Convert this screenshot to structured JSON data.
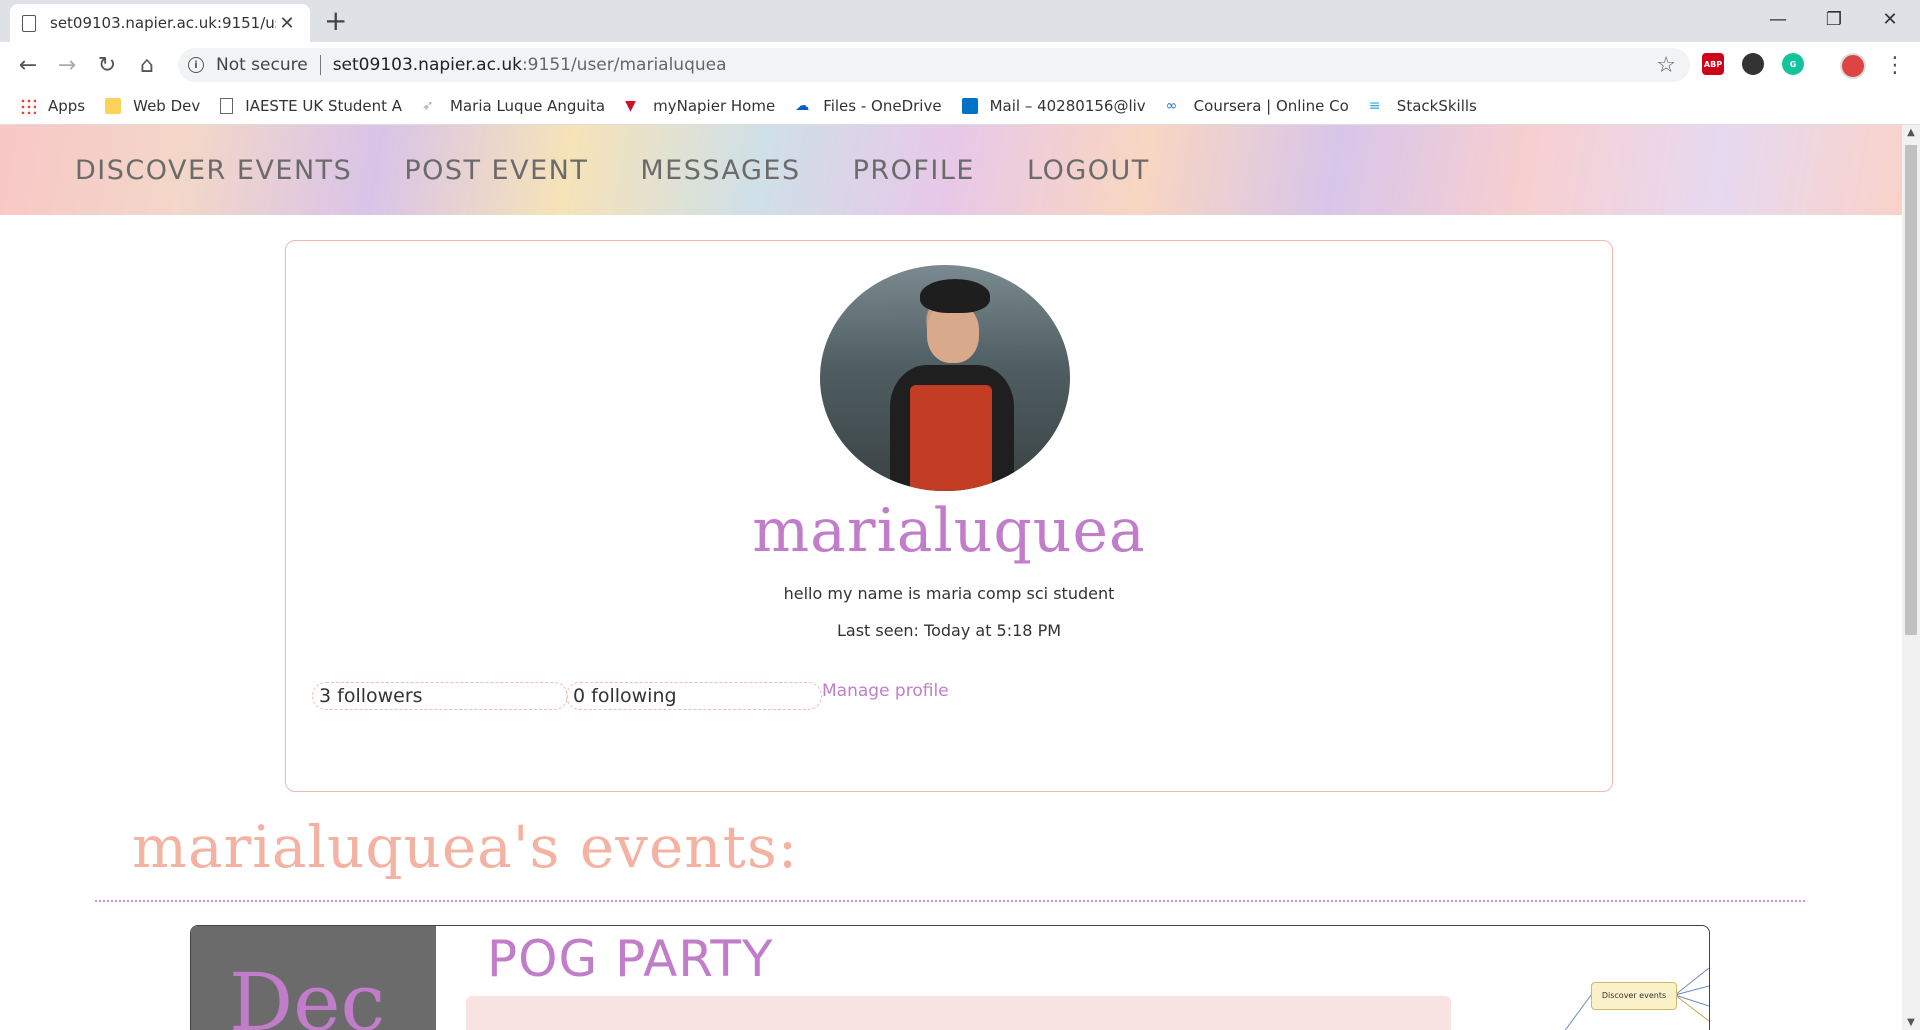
{
  "browser": {
    "tab_title": "set09103.napier.ac.uk:9151/user/",
    "address_security": "Not secure",
    "url_host": "set09103.napier.ac.uk",
    "url_path": ":9151/user/marialuquea",
    "bookmarks": [
      {
        "label": "Apps",
        "icon": "apps-grid-icon",
        "color": "#ea4335"
      },
      {
        "label": "Web Dev",
        "icon": "folder-icon",
        "color": "#fbd35a"
      },
      {
        "label": "IAESTE UK Student A",
        "icon": "page-icon",
        "color": "#666666"
      },
      {
        "label": "Maria Luque Anguita",
        "icon": "paper-plane-icon",
        "color": "#aaaaaa"
      },
      {
        "label": "myNapier Home",
        "icon": "napier-flag-icon",
        "color": "#d0102a"
      },
      {
        "label": "Files - OneDrive",
        "icon": "cloud-icon",
        "color": "#0a5cc7"
      },
      {
        "label": "Mail – 40280156@liv",
        "icon": "outlook-icon",
        "color": "#0072c6"
      },
      {
        "label": "Coursera | Online Co",
        "icon": "coursera-icon",
        "color": "#2a73cc"
      },
      {
        "label": "StackSkills",
        "icon": "stack-icon",
        "color": "#2da7e0"
      }
    ]
  },
  "nav": {
    "items": [
      "Discover Events",
      "Post Event",
      "Messages",
      "Profile",
      "Logout"
    ]
  },
  "profile": {
    "username": "marialuquea",
    "bio": "hello my name is maria comp sci student",
    "last_seen": "Last seen: Today at 5:18 PM",
    "followers": "3 followers",
    "following": "0 following",
    "manage_label": "Manage profile"
  },
  "events_section": {
    "title": "marialuquea's events:"
  },
  "event": {
    "month": "Dec",
    "title": "POG PARTY",
    "image_node_label": "Discover events"
  }
}
